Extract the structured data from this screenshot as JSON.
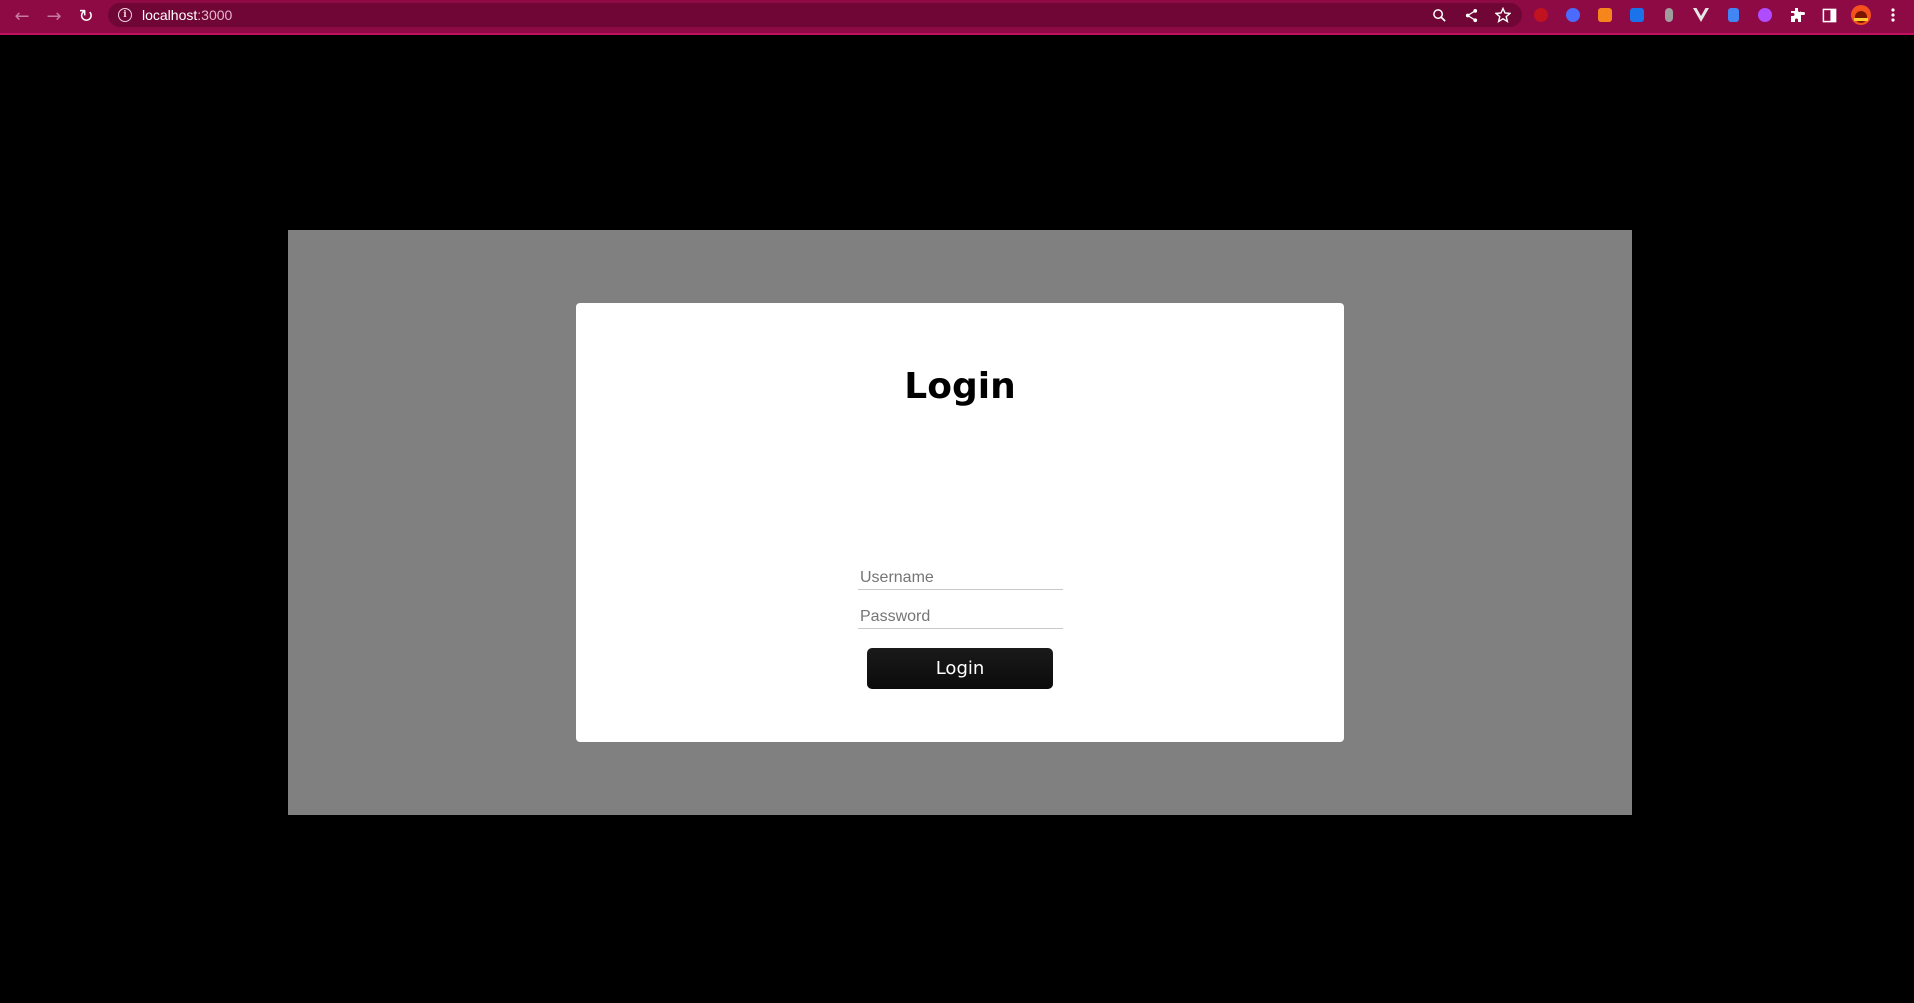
{
  "browser": {
    "url_host": "localhost",
    "url_port": ":3000",
    "toolbar_icons": [
      "back-arrow-icon",
      "forward-arrow-icon",
      "reload-icon",
      "info-icon"
    ],
    "omnibox_actions": [
      "zoom-icon",
      "share-icon",
      "bookmark-star-icon"
    ],
    "extensions": [
      {
        "name": "ublock-icon",
        "color": "#c1121f"
      },
      {
        "name": "extension-blue-icon",
        "color": "#4b6bff"
      },
      {
        "name": "metamask-icon",
        "color": "#f6851b"
      },
      {
        "name": "translate-icon",
        "color": "#1a73e8"
      },
      {
        "name": "extension-grey-icon",
        "color": "#9e9e9e"
      },
      {
        "name": "vue-devtools-icon",
        "color": "#e6e6e6"
      },
      {
        "name": "extension-doc-icon",
        "color": "#4285f4"
      },
      {
        "name": "extension-purple-icon",
        "color": "#b04cff"
      },
      {
        "name": "puzzle-icon",
        "color": "#ffffff"
      },
      {
        "name": "side-panel-icon",
        "color": "#ffffff"
      },
      {
        "name": "profile-avatar-icon",
        "color": "#f4511e"
      },
      {
        "name": "kebab-menu-icon",
        "color": "#ffffff"
      }
    ]
  },
  "colors": {
    "chrome_bg": "#8d0a45",
    "page_bg": "#000000",
    "overlay_bg": "#808080",
    "card_bg": "#ffffff",
    "button_bg": "#111111"
  },
  "login": {
    "title": "Login",
    "username_placeholder": "Username",
    "password_placeholder": "Password",
    "button_label": "Login"
  }
}
